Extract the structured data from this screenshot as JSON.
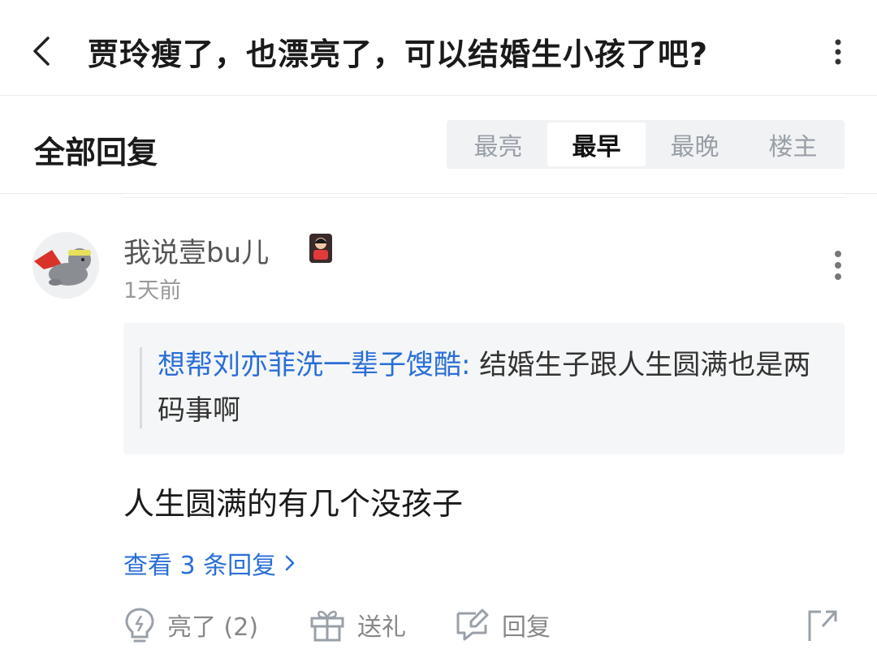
{
  "header": {
    "title": "贾玲瘦了，也漂亮了，可以结婚生小孩了吧?"
  },
  "replies_section": {
    "title": "全部回复",
    "sort_tabs": [
      {
        "label": "最亮",
        "active": false
      },
      {
        "label": "最早",
        "active": true
      },
      {
        "label": "最晚",
        "active": false
      },
      {
        "label": "楼主",
        "active": false
      }
    ]
  },
  "comment": {
    "username": "我说壹bu儿",
    "time": "1天前",
    "quote": {
      "author": "想帮刘亦菲洗一辈子馊酷:",
      "text": " 结婚生子跟人生圆满也是两码事啊"
    },
    "text": "人生圆满的有几个没孩子",
    "view_replies": "查看 3 条回复",
    "actions": {
      "like": "亮了 (2)",
      "gift": "送礼",
      "reply": "回复"
    }
  },
  "colors": {
    "link": "#2a6fd6",
    "muted": "#888888",
    "active_tab_bg": "#ffffff",
    "tabs_bg": "#f1f2f4"
  },
  "icons": [
    "back-arrow-icon",
    "more-vertical-icon",
    "lightbulb-icon",
    "gift-icon",
    "reply-edit-icon",
    "share-icon",
    "chevron-right-icon"
  ]
}
